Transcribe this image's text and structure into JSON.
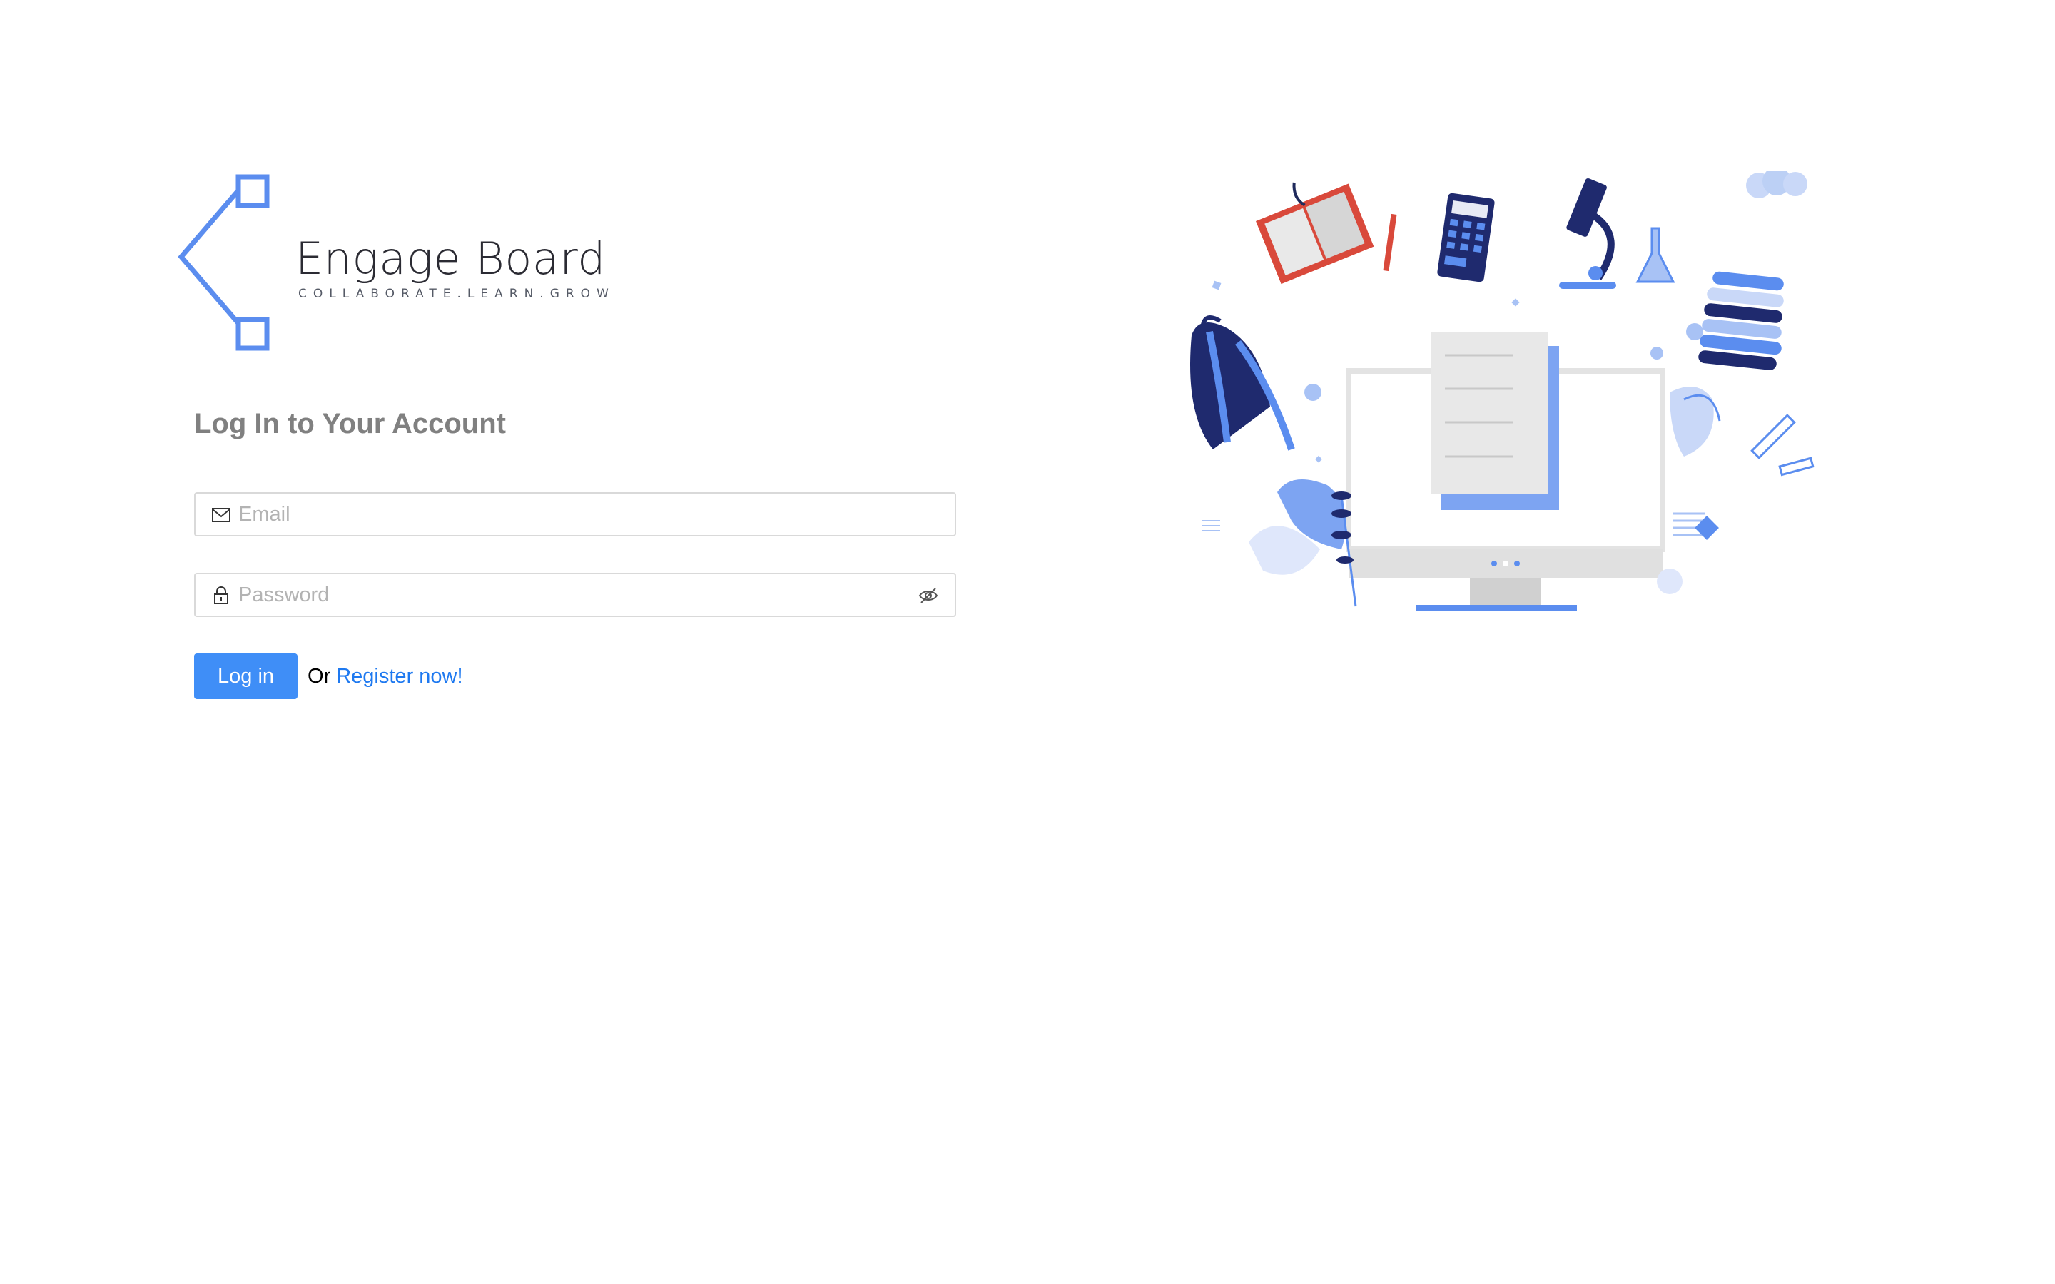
{
  "brand": {
    "name": "Engage Board",
    "tagline": "COLLABORATE.LEARN.GROW",
    "accent_color": "#5b8def"
  },
  "login": {
    "heading": "Log In to Your Account",
    "email": {
      "placeholder": "Email",
      "value": "",
      "icon": "mail-icon"
    },
    "password": {
      "placeholder": "Password",
      "value": "",
      "icon": "lock-icon",
      "toggle_icon": "eye-invisible-icon"
    },
    "submit_label": "Log in",
    "or_text": "Or",
    "register_label": "Register now!"
  },
  "colors": {
    "primary_button": "#3f8ef7",
    "link": "#1e79f0",
    "heading": "#808080",
    "input_border": "#d9d9d9"
  }
}
